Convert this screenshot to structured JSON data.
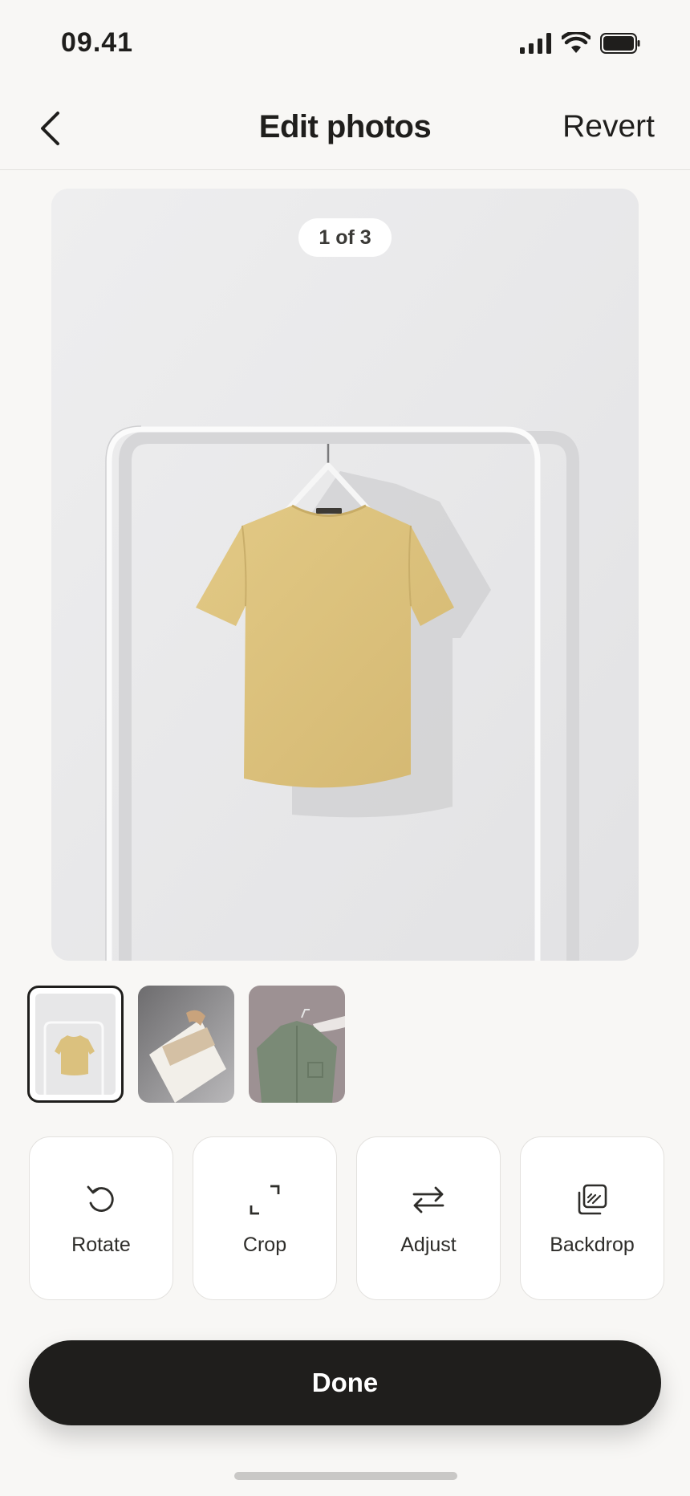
{
  "status_bar": {
    "time": "09.41"
  },
  "nav": {
    "title": "Edit photos",
    "revert_label": "Revert"
  },
  "photo": {
    "counter": "1 of 3",
    "item": "yellow t-shirt on hanger"
  },
  "thumbnails": [
    {
      "name": "yellow t-shirt",
      "selected": true
    },
    {
      "name": "folded shirt",
      "selected": false
    },
    {
      "name": "green shirt",
      "selected": false
    }
  ],
  "tools": [
    {
      "label": "Rotate",
      "icon": "rotate-icon"
    },
    {
      "label": "Crop",
      "icon": "crop-icon"
    },
    {
      "label": "Adjust",
      "icon": "adjust-icon"
    },
    {
      "label": "Backdrop",
      "icon": "backdrop-icon"
    }
  ],
  "done_label": "Done",
  "colors": {
    "primary": "#1f1e1c",
    "background": "#f8f7f5",
    "shirt": "#dcc27e"
  }
}
